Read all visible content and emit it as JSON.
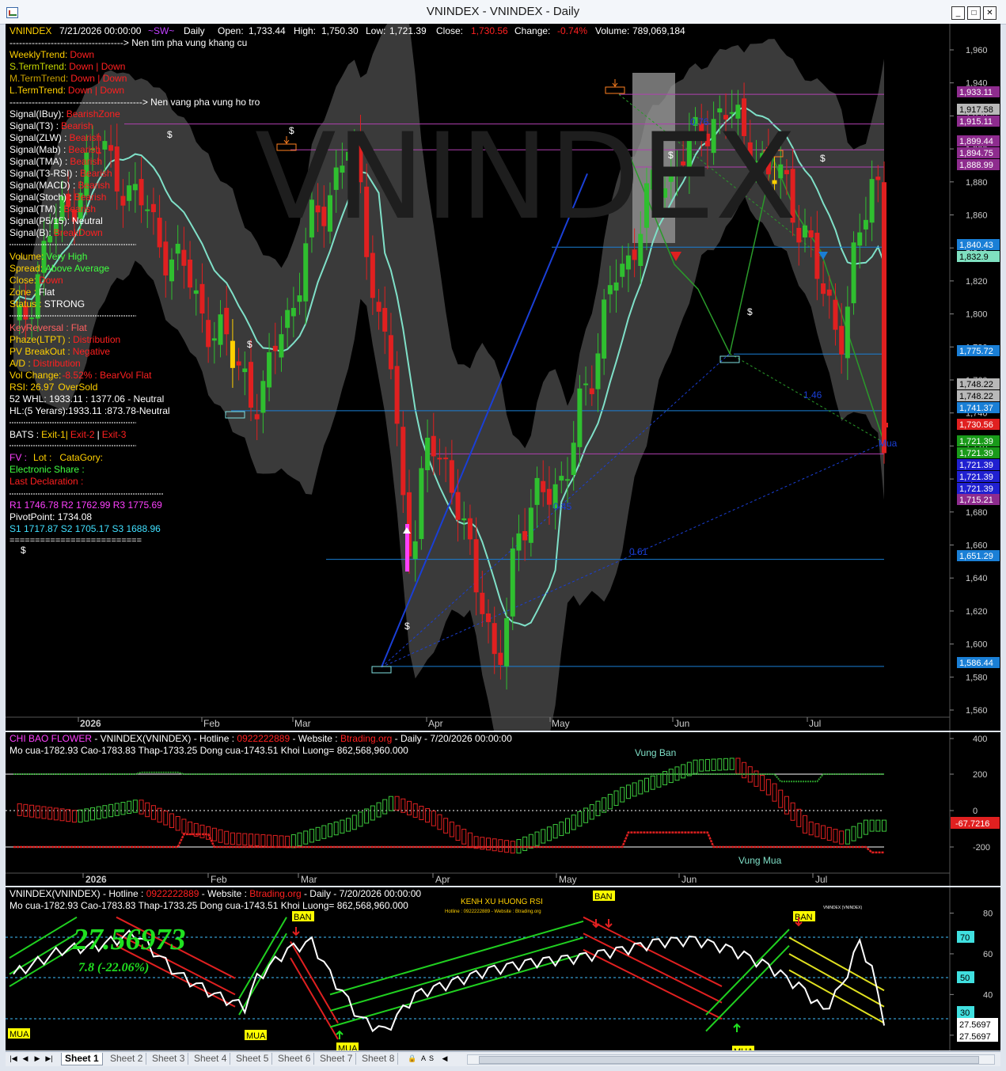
{
  "window": {
    "title": "VNINDEX - VNINDEX - Daily",
    "buttons": [
      "_",
      "□",
      "✕"
    ]
  },
  "price_pane": {
    "header": {
      "symbol": "VNINDEX",
      "datetime": "7/21/2026 00:00:00",
      "sw": "~SW~",
      "period": "Daily",
      "open_label": "Open:",
      "open": "1,733.44",
      "high_label": "High:",
      "high": "1,750.30",
      "low_label": "Low:",
      "low": "1,721.39",
      "close_label": "Close:",
      "close": "1,730.56",
      "change_label": "Change:",
      "change": "-0.74%",
      "volume_label": "Volume:",
      "volume": "789,069,184"
    },
    "arrow_line1": "------------------------------------> Nen tim pha vung khang cu",
    "arrow_line2": "------------------------------------------> Nen vang pha vung ho tro",
    "trends": [
      {
        "label": "WeeklyTrend:",
        "value": "Down"
      },
      {
        "label": "S.TermTrend:",
        "value": "Down | Down"
      },
      {
        "label": "M.TermTrend:",
        "value": "Down | Down"
      },
      {
        "label": "L.TermTrend:",
        "value": "Down | Down"
      }
    ],
    "signals": [
      {
        "label": "Signal(IBuy):",
        "value": "BearishZone"
      },
      {
        "label": "Signal(T3)   :",
        "value": "Bearish"
      },
      {
        "label": "Signal(ZLW) :",
        "value": "Bearish"
      },
      {
        "label": "Signal(Mab) :",
        "value": "Bearish"
      },
      {
        "label": "Signal(TMA)  :",
        "value": "Bearish"
      },
      {
        "label": "Signal(T3-RSI) :",
        "value": "Bearish"
      },
      {
        "label": "Signal(MACD) :",
        "value": "Bearish"
      },
      {
        "label": "Signal(Stoch) :",
        "value": "Bearish"
      },
      {
        "label": "Signal(TM) :",
        "value": "Bearish"
      },
      {
        "label": "Signal(P5/15):",
        "value": "Neutral"
      },
      {
        "label": "Signal(B):",
        "value": "BreakDown"
      }
    ],
    "volume_info": [
      {
        "label": "Volume:",
        "value": "Very High"
      },
      {
        "label": "Spread:",
        "value": "Above Average"
      },
      {
        "label": "Close:",
        "value": "Down"
      },
      {
        "label": "Zone :",
        "value": "Flat"
      },
      {
        "label": "Status :",
        "value": "STRONG"
      }
    ],
    "phase_info": [
      {
        "label": "KeyReversal :",
        "value": "Flat"
      },
      {
        "label": "Phaze(LTPT) :",
        "value": "Distribution"
      },
      {
        "label": "PV BreakOut :",
        "value": "Negative"
      },
      {
        "label": "A/D :",
        "value": "Distribution"
      }
    ],
    "vol_change": {
      "label": "Vol Change:",
      "pct": "-8.52%",
      "value": ": BearVol Flat"
    },
    "rsi": {
      "label": "RSI:",
      "value": "26.97",
      "state": "OverSold"
    },
    "whl": "52 WHL: 1933.11 : 1377.06 - Neutral",
    "hl5": "HL:(5 Yerars):1933.11 :873.78-Neutral",
    "bats": {
      "label": "BATS :",
      "exit1": "Exit-1|",
      "exit2": "Exit-2",
      "sep": "|",
      "exit3": "Exit-3"
    },
    "fv": {
      "fv": "FV :",
      "lot": "Lot :",
      "cat": "CataGory:"
    },
    "electronic": "Electronic Share :",
    "last_decl": "Last Declaration :",
    "pivots": {
      "r": "R1 1746.78 R2 1762.99 R3 1775.69",
      "pivot": "PivotPoint: 1734.08",
      "s": "S1 1717.87 S2 1705.17 S3 1688.96",
      "eq": "=========================="
    },
    "dollar": "$",
    "mua_label": "Mua",
    "watermark": "VNINDEX",
    "fib_labels": [
      "0.76",
      "1.46",
      "0.45",
      "0.61"
    ],
    "y_ticks": [
      "1,960",
      "1,940",
      "1,920",
      "1,900",
      "1,880",
      "1,860",
      "1,840",
      "1,820",
      "1,800",
      "1,780",
      "1,760",
      "1,740",
      "1,720",
      "1,700",
      "1,680",
      "1,660",
      "1,640",
      "1,620",
      "1,600",
      "1,580",
      "1,560"
    ],
    "months": [
      "2026",
      "Feb",
      "Mar",
      "Apr",
      "May",
      "Jun",
      "Jul"
    ],
    "price_boxes": [
      {
        "text": "1,933.11",
        "color": "#8e2c8e"
      },
      {
        "text": "1,917.58",
        "color": "#b8b8b8"
      },
      {
        "text": "1,915.11",
        "color": "#8e2c8e"
      },
      {
        "text": "1,899.44",
        "color": "#8e2c8e"
      },
      {
        "text": "1,894.75",
        "color": "#8e2c8e"
      },
      {
        "text": "1,888.99",
        "color": "#8e2c8e"
      },
      {
        "text": "1,840.43",
        "color": "#1a7fd6"
      },
      {
        "text": "1,832.9",
        "color": "#7fe0c0"
      },
      {
        "text": "1,775.72",
        "color": "#1a7fd6"
      },
      {
        "text": "1,748.22",
        "color": "#b8b8b8"
      },
      {
        "text": "1,748.22",
        "color": "#b8b8b8"
      },
      {
        "text": "1,741.37",
        "color": "#1a7fd6"
      },
      {
        "text": "1,730.56",
        "color": "#e02020"
      },
      {
        "text": "1,721.39",
        "color": "#1a9a1a"
      },
      {
        "text": "1,721.39",
        "color": "#1a9a1a"
      },
      {
        "text": "1,721.39",
        "color": "#2020d0"
      },
      {
        "text": "1,721.39",
        "color": "#2020d0"
      },
      {
        "text": "1,721.39",
        "color": "#2020d0"
      },
      {
        "text": "1,715.21",
        "color": "#8e2c8e"
      },
      {
        "text": "1,651.29",
        "color": "#1a7fd6"
      },
      {
        "text": "1,586.44",
        "color": "#1a7fd6"
      }
    ]
  },
  "flower_pane": {
    "title_parts": {
      "name": "CHI BAO FLOWER",
      "sym": " - VNINDEX(VNINDEX) - Hotline : ",
      "hotline": "0922222889",
      "web_label": " - Website : ",
      "web": "Btrading.org",
      "rest": " - Daily  - 7/20/2026 00:00:00"
    },
    "ohlc": "Mo cua-1782.93  Cao-1783.83  Thap-1733.25  Dong cua-1743.51  Khoi Luong= 862,568,960.000",
    "vung_ban": "Vung Ban",
    "vung_mua": "Vung Mua",
    "y_ticks": [
      "400",
      "200",
      "0",
      "-200"
    ],
    "last_value": "-67.7216",
    "months": [
      "2026",
      "Feb",
      "Mar",
      "Apr",
      "May",
      "Jun",
      "Jul"
    ]
  },
  "rsi_pane": {
    "title_parts": {
      "sym": "VNINDEX(VNINDEX) - Hotline : ",
      "hotline": "0922222889",
      "web_label": " - Website : ",
      "web": "Btrading.org",
      "rest": " - Daily  - 7/20/2026 00:00:00"
    },
    "ohlc": "Mo cua-1782.93  Cao-1783.83  Thap-1733.25  Dong cua-1743.51  Khoi Luong= 862,568,960.000",
    "kenh_title": "KENH XU HUONG RSI",
    "kenh_sub": "Hotline : 0922222889 - Website : Btrading.org",
    "big_value": "27.56973",
    "sub_value": "7.8 (-22.06%)",
    "small_label": "VNINDEX\n(VNINDEX)",
    "mua": "MUA",
    "ban": "BAN",
    "levels": [
      "70",
      "50",
      "30"
    ],
    "y_ticks": [
      "80",
      "60",
      "40",
      "20"
    ],
    "last_values": [
      "27.5697",
      "27.5697"
    ]
  },
  "tabs": {
    "nav": [
      "|◀",
      "◀",
      "▶",
      "▶|"
    ],
    "sheets": [
      "Sheet 1",
      "Sheet 2",
      "Sheet 3",
      "Sheet 4",
      "Sheet 5",
      "Sheet 6",
      "Sheet 7",
      "Sheet 8"
    ],
    "active": "Sheet 1",
    "extras": [
      "A",
      "S"
    ]
  },
  "colors": {
    "up": "#2fbf2f",
    "down": "#e02020",
    "band": "#3a3a3a",
    "ma": "#7fe0c8",
    "fib_purple": "#b040b0",
    "support_blue": "#1a7fd6",
    "trend_blue": "#1a3fd6"
  }
}
